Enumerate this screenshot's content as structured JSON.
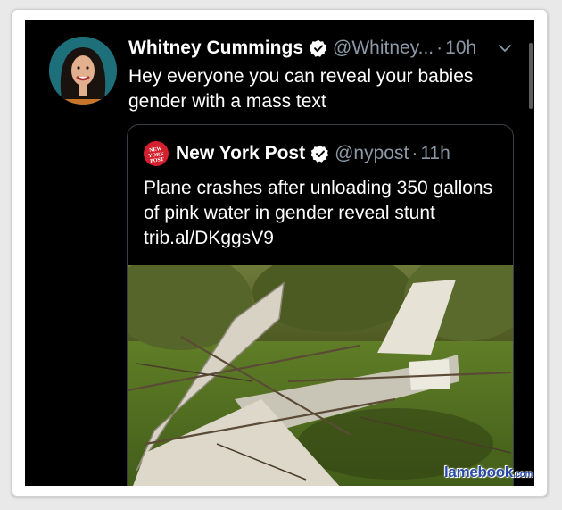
{
  "tweet": {
    "author_name": "Whitney Cummings",
    "handle": "@Whitney...",
    "separator": "·",
    "time": "10h",
    "text": "Hey everyone you can reveal your babies gender with a mass text",
    "icons": {
      "verified": "verified-badge-icon",
      "menu": "chevron-down-icon"
    }
  },
  "quoted": {
    "logo_text": "NEW YORK POST",
    "author_name": "New York Post",
    "handle": "@nypost",
    "separator": "·",
    "time": "11h",
    "text": "Plane crashes after unloading 350 gallons of pink water in gender reveal stunt trib.al/DKggsV9"
  },
  "watermark": {
    "main": "lamebook",
    "suffix": ".com"
  },
  "colors": {
    "background": "#000000",
    "muted": "#8b98a5",
    "nyp_red": "#d3202e",
    "border": "#3a3f44"
  }
}
